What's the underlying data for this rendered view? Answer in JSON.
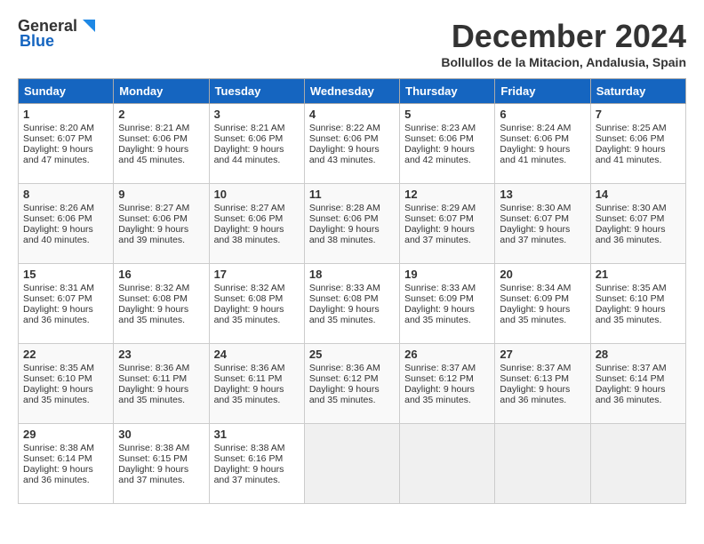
{
  "header": {
    "logo_line1": "General",
    "logo_line2": "Blue",
    "month": "December 2024",
    "location": "Bollullos de la Mitacion, Andalusia, Spain"
  },
  "weekdays": [
    "Sunday",
    "Monday",
    "Tuesday",
    "Wednesday",
    "Thursday",
    "Friday",
    "Saturday"
  ],
  "weeks": [
    [
      {
        "day": 1,
        "sunrise": "8:20 AM",
        "sunset": "6:07 PM",
        "daylight": "9 hours and 47 minutes."
      },
      {
        "day": 2,
        "sunrise": "8:21 AM",
        "sunset": "6:06 PM",
        "daylight": "9 hours and 45 minutes."
      },
      {
        "day": 3,
        "sunrise": "8:21 AM",
        "sunset": "6:06 PM",
        "daylight": "9 hours and 44 minutes."
      },
      {
        "day": 4,
        "sunrise": "8:22 AM",
        "sunset": "6:06 PM",
        "daylight": "9 hours and 43 minutes."
      },
      {
        "day": 5,
        "sunrise": "8:23 AM",
        "sunset": "6:06 PM",
        "daylight": "9 hours and 42 minutes."
      },
      {
        "day": 6,
        "sunrise": "8:24 AM",
        "sunset": "6:06 PM",
        "daylight": "9 hours and 41 minutes."
      },
      {
        "day": 7,
        "sunrise": "8:25 AM",
        "sunset": "6:06 PM",
        "daylight": "9 hours and 41 minutes."
      }
    ],
    [
      {
        "day": 8,
        "sunrise": "8:26 AM",
        "sunset": "6:06 PM",
        "daylight": "9 hours and 40 minutes."
      },
      {
        "day": 9,
        "sunrise": "8:27 AM",
        "sunset": "6:06 PM",
        "daylight": "9 hours and 39 minutes."
      },
      {
        "day": 10,
        "sunrise": "8:27 AM",
        "sunset": "6:06 PM",
        "daylight": "9 hours and 38 minutes."
      },
      {
        "day": 11,
        "sunrise": "8:28 AM",
        "sunset": "6:06 PM",
        "daylight": "9 hours and 38 minutes."
      },
      {
        "day": 12,
        "sunrise": "8:29 AM",
        "sunset": "6:07 PM",
        "daylight": "9 hours and 37 minutes."
      },
      {
        "day": 13,
        "sunrise": "8:30 AM",
        "sunset": "6:07 PM",
        "daylight": "9 hours and 37 minutes."
      },
      {
        "day": 14,
        "sunrise": "8:30 AM",
        "sunset": "6:07 PM",
        "daylight": "9 hours and 36 minutes."
      }
    ],
    [
      {
        "day": 15,
        "sunrise": "8:31 AM",
        "sunset": "6:07 PM",
        "daylight": "9 hours and 36 minutes."
      },
      {
        "day": 16,
        "sunrise": "8:32 AM",
        "sunset": "6:08 PM",
        "daylight": "9 hours and 35 minutes."
      },
      {
        "day": 17,
        "sunrise": "8:32 AM",
        "sunset": "6:08 PM",
        "daylight": "9 hours and 35 minutes."
      },
      {
        "day": 18,
        "sunrise": "8:33 AM",
        "sunset": "6:08 PM",
        "daylight": "9 hours and 35 minutes."
      },
      {
        "day": 19,
        "sunrise": "8:33 AM",
        "sunset": "6:09 PM",
        "daylight": "9 hours and 35 minutes."
      },
      {
        "day": 20,
        "sunrise": "8:34 AM",
        "sunset": "6:09 PM",
        "daylight": "9 hours and 35 minutes."
      },
      {
        "day": 21,
        "sunrise": "8:35 AM",
        "sunset": "6:10 PM",
        "daylight": "9 hours and 35 minutes."
      }
    ],
    [
      {
        "day": 22,
        "sunrise": "8:35 AM",
        "sunset": "6:10 PM",
        "daylight": "9 hours and 35 minutes."
      },
      {
        "day": 23,
        "sunrise": "8:36 AM",
        "sunset": "6:11 PM",
        "daylight": "9 hours and 35 minutes."
      },
      {
        "day": 24,
        "sunrise": "8:36 AM",
        "sunset": "6:11 PM",
        "daylight": "9 hours and 35 minutes."
      },
      {
        "day": 25,
        "sunrise": "8:36 AM",
        "sunset": "6:12 PM",
        "daylight": "9 hours and 35 minutes."
      },
      {
        "day": 26,
        "sunrise": "8:37 AM",
        "sunset": "6:12 PM",
        "daylight": "9 hours and 35 minutes."
      },
      {
        "day": 27,
        "sunrise": "8:37 AM",
        "sunset": "6:13 PM",
        "daylight": "9 hours and 36 minutes."
      },
      {
        "day": 28,
        "sunrise": "8:37 AM",
        "sunset": "6:14 PM",
        "daylight": "9 hours and 36 minutes."
      }
    ],
    [
      {
        "day": 29,
        "sunrise": "8:38 AM",
        "sunset": "6:14 PM",
        "daylight": "9 hours and 36 minutes."
      },
      {
        "day": 30,
        "sunrise": "8:38 AM",
        "sunset": "6:15 PM",
        "daylight": "9 hours and 37 minutes."
      },
      {
        "day": 31,
        "sunrise": "8:38 AM",
        "sunset": "6:16 PM",
        "daylight": "9 hours and 37 minutes."
      },
      null,
      null,
      null,
      null
    ]
  ]
}
